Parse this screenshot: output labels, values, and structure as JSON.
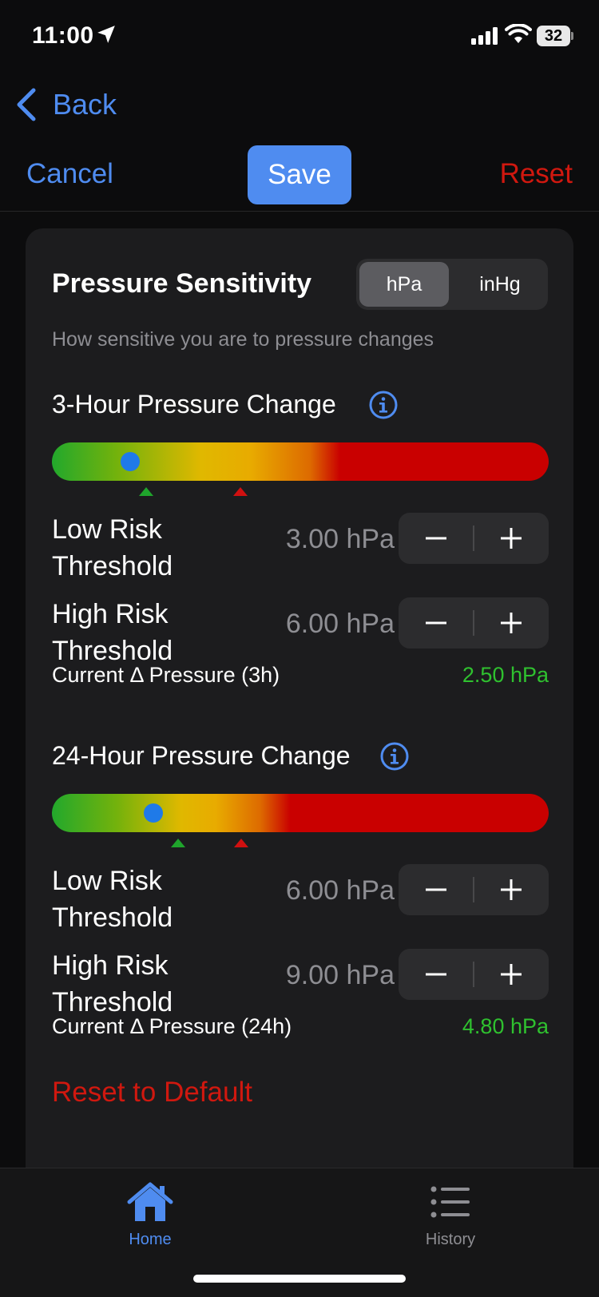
{
  "status_bar": {
    "time": "11:00",
    "battery": "32"
  },
  "nav": {
    "back_label": "Back"
  },
  "toolbar": {
    "cancel_label": "Cancel",
    "save_label": "Save",
    "reset_label": "Reset"
  },
  "card": {
    "title": "Pressure Sensitivity",
    "subtitle": "How sensitive you are to pressure changes",
    "units": {
      "options": [
        "hPa",
        "inHg"
      ],
      "selected": "hPa"
    },
    "sections": [
      {
        "title": "3-Hour Pressure Change",
        "low_label": "Low Risk Threshold",
        "low_label_line1": "Low Risk",
        "low_label_line2": "Threshold",
        "low_value": "3.00 hPa",
        "high_label_line1": "High Risk",
        "high_label_line2": "Threshold",
        "high_value": "6.00 hPa",
        "current_label": "Current Δ Pressure (3h)",
        "current_value": "2.50 hPa",
        "current_level": 2.5,
        "low_level": 3.0,
        "high_level": 6.0
      },
      {
        "title": "24-Hour Pressure Change",
        "low_label_line1": "Low Risk",
        "low_label_line2": "Threshold",
        "low_value": "6.00 hPa",
        "high_label_line1": "High Risk",
        "high_label_line2": "Threshold",
        "high_value": "9.00 hPa",
        "current_label": "Current Δ Pressure (24h)",
        "current_value": "4.80 hPa",
        "current_level": 4.8,
        "low_level": 6.0,
        "high_level": 9.0
      }
    ],
    "reset_default_label": "Reset to Default"
  },
  "tabs": [
    {
      "label": "Home",
      "icon": "house-icon",
      "active": true
    },
    {
      "label": "History",
      "icon": "list-icon",
      "active": false
    }
  ],
  "colors": {
    "accent": "#4f8cf0",
    "danger": "#d0180f",
    "success": "#2fc12f",
    "indicator": "#1f7ae8"
  }
}
